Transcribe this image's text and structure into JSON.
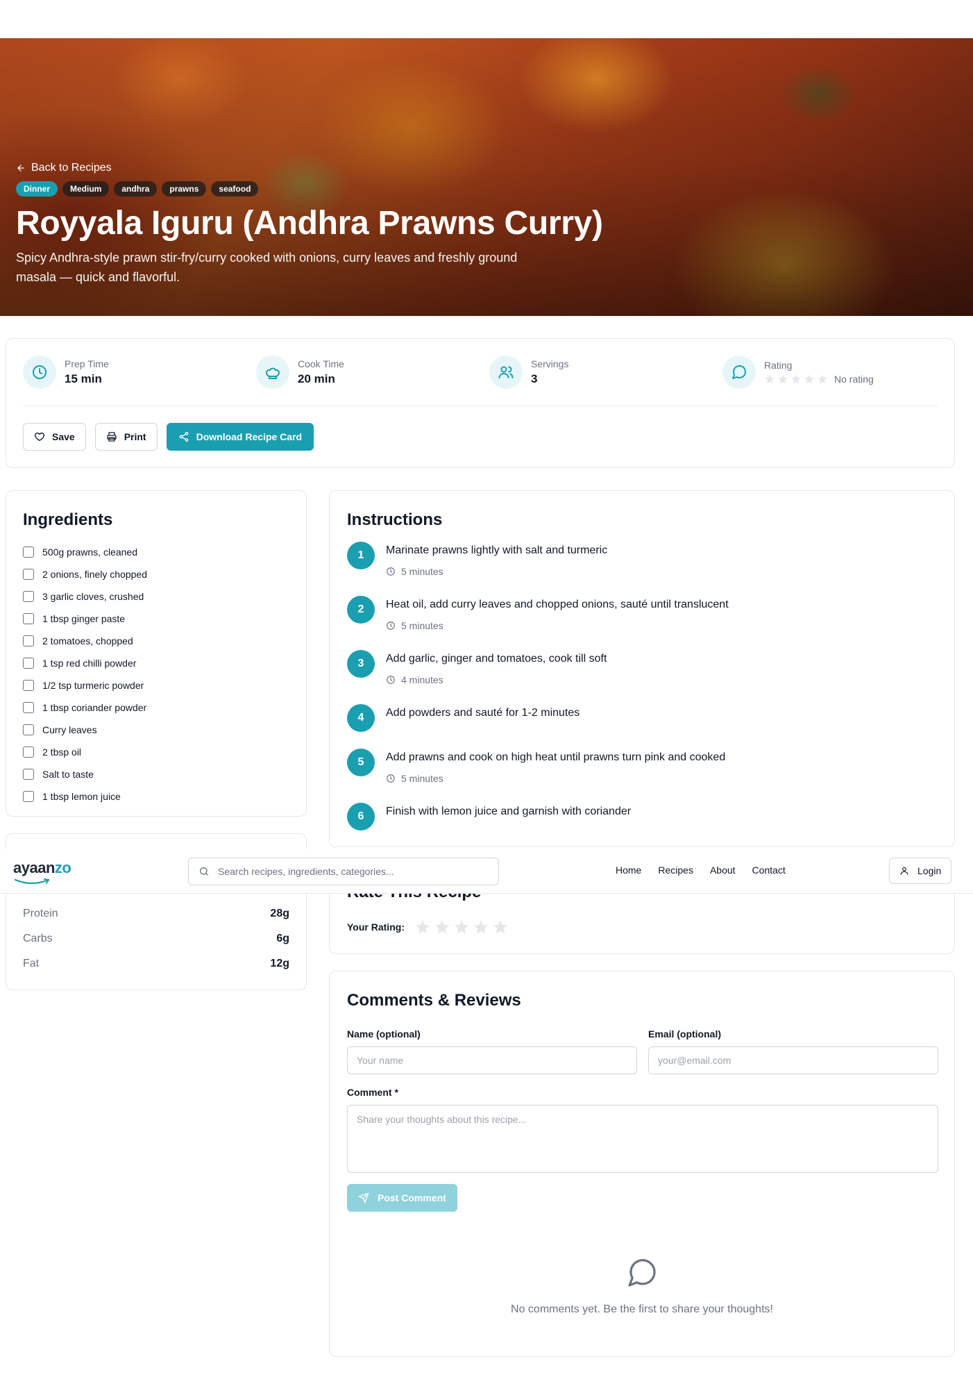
{
  "hero": {
    "back_label": "Back to Recipes",
    "tags": [
      "Dinner",
      "Medium",
      "andhra",
      "prawns",
      "seafood"
    ],
    "title": "Royyala Iguru (Andhra Prawns Curry)",
    "description": "Spicy Andhra-style prawn stir-fry/curry cooked with onions, curry leaves and freshly ground masala — quick and flavorful."
  },
  "meta": {
    "prep": {
      "label": "Prep Time",
      "value": "15 min",
      "icon": "clock-icon"
    },
    "cook": {
      "label": "Cook Time",
      "value": "20 min",
      "icon": "chef-hat-icon"
    },
    "servings": {
      "label": "Servings",
      "value": "3",
      "icon": "users-icon"
    },
    "rating": {
      "label": "Rating",
      "value": "No rating",
      "stars": 5,
      "filled": 0,
      "icon": "message-circle-icon"
    }
  },
  "actions": {
    "save": "Save",
    "print": "Print",
    "download": "Download Recipe Card"
  },
  "ingredients": {
    "title": "Ingredients",
    "items": [
      "500g prawns, cleaned",
      "2 onions, finely chopped",
      "3 garlic cloves, crushed",
      "1 tbsp ginger paste",
      "2 tomatoes, chopped",
      "1 tsp red chilli powder",
      "1/2 tsp turmeric powder",
      "1 tbsp coriander powder",
      "Curry leaves",
      "2 tbsp oil",
      "Salt to taste",
      "1 tbsp lemon juice"
    ]
  },
  "nutrition": {
    "rows": [
      {
        "label": "Protein",
        "value": "28g"
      },
      {
        "label": "Carbs",
        "value": "6g"
      },
      {
        "label": "Fat",
        "value": "12g"
      }
    ]
  },
  "instructions": {
    "title": "Instructions",
    "steps": [
      {
        "num": "1",
        "text": "Marinate prawns lightly with salt and turmeric",
        "time": "5 minutes"
      },
      {
        "num": "2",
        "text": "Heat oil, add curry leaves and chopped onions, sauté until translucent",
        "time": "5 minutes"
      },
      {
        "num": "3",
        "text": "Add garlic, ginger and tomatoes, cook till soft",
        "time": "4 minutes"
      },
      {
        "num": "4",
        "text": "Add powders and sauté for 1-2 minutes",
        "time": ""
      },
      {
        "num": "5",
        "text": "Add prawns and cook on high heat until prawns turn pink and cooked",
        "time": "5 minutes"
      },
      {
        "num": "6",
        "text": "Finish with lemon juice and garnish with coriander",
        "time": ""
      }
    ]
  },
  "rate": {
    "title": "Rate This Recipe",
    "label": "Your Rating:",
    "stars": 5
  },
  "comments": {
    "title": "Comments & Reviews",
    "name_label": "Name (optional)",
    "name_placeholder": "Your name",
    "email_label": "Email (optional)",
    "email_placeholder": "your@email.com",
    "comment_label": "Comment *",
    "comment_placeholder": "Share your thoughts about this recipe...",
    "post_label": "Post Comment",
    "empty_text": "No comments yet. Be the first to share your thoughts!"
  },
  "header": {
    "logo_prefix": "ayaan",
    "logo_suffix": "zo",
    "search_placeholder": "Search recipes, ingredients, categories...",
    "nav": [
      "Home",
      "Recipes",
      "About",
      "Contact"
    ],
    "login": "Login"
  },
  "colors": {
    "accent": "#1a9fb0",
    "accent_light": "#e6f6f8",
    "muted": "#6b7280",
    "border": "#e5e7eb"
  }
}
